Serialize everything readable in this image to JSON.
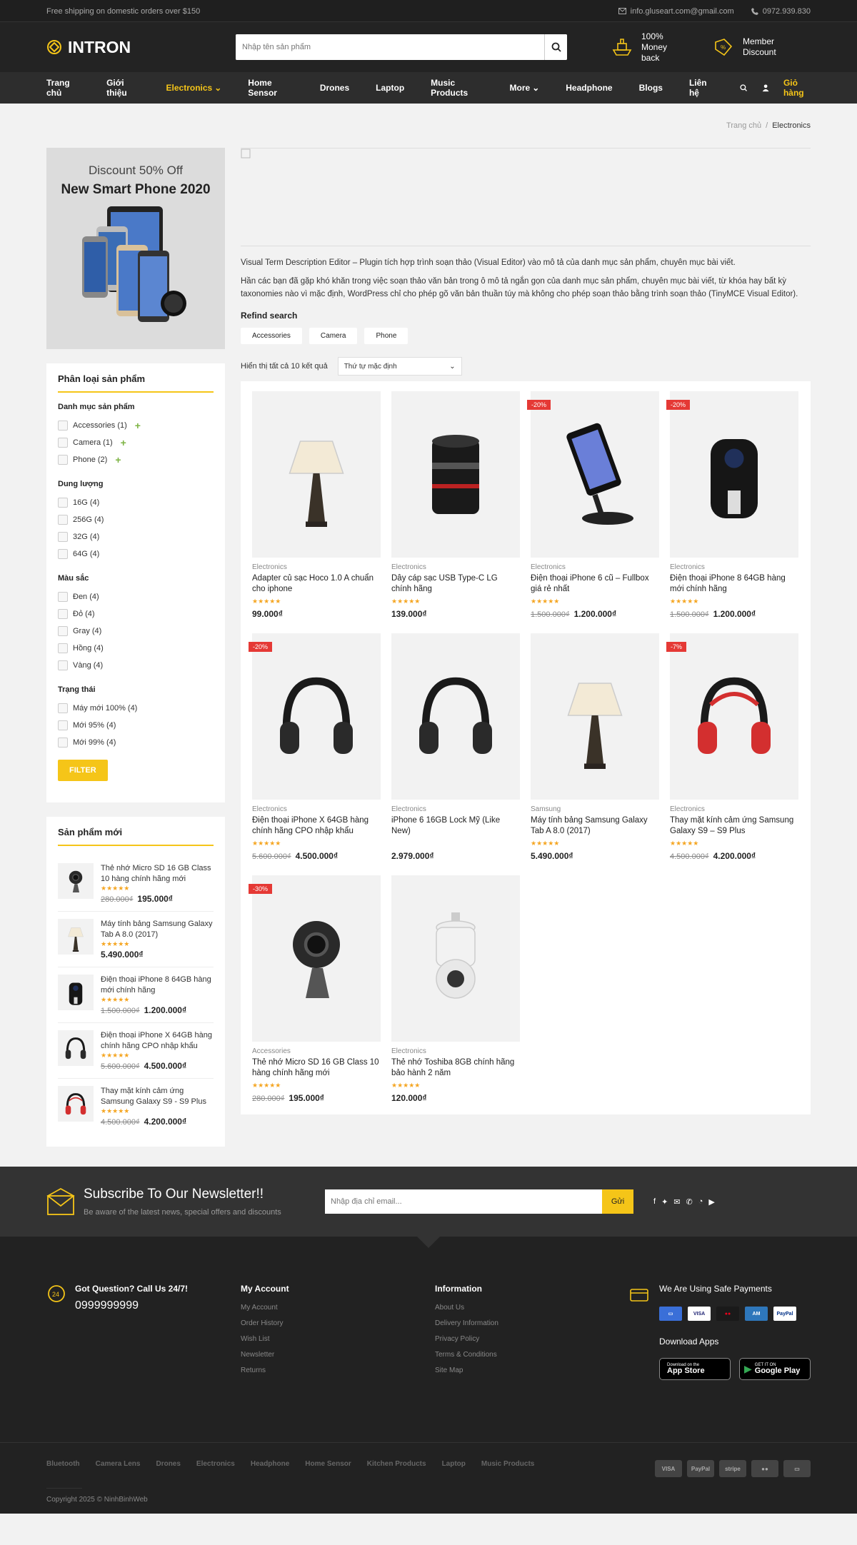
{
  "topbar": {
    "shipping": "Free shipping on domestic orders over $150",
    "email": "info.gluseart.com@gmail.com",
    "phone": "0972.939.830"
  },
  "header": {
    "logo": "INTRON",
    "search_placeholder": "Nhập tên sản phẩm",
    "perk1": "100% Money back",
    "perk2": "Member Discount"
  },
  "nav": {
    "items": [
      "Trang chủ",
      "Giới thiệu",
      "Electronics",
      "Home Sensor",
      "Drones",
      "Laptop",
      "Music Products",
      "More",
      "Headphone",
      "Blogs",
      "Liên hệ"
    ],
    "cart": "Giỏ hàng"
  },
  "breadcrumb": {
    "home": "Trang chủ",
    "sep": "/",
    "current": "Electronics"
  },
  "banner": {
    "line1": "Discount 50% Off",
    "line2": "New Smart Phone 2020"
  },
  "filters": {
    "title": "Phân loại sản phẩm",
    "cat_title": "Danh mục sản phẩm",
    "cats": [
      "Accessories (1)",
      "Camera (1)",
      "Phone (2)"
    ],
    "cap_title": "Dung lượng",
    "caps": [
      "16G (4)",
      "256G (4)",
      "32G (4)",
      "64G (4)"
    ],
    "color_title": "Màu sắc",
    "colors": [
      "Đen (4)",
      "Đỏ (4)",
      "Gray (4)",
      "Hồng (4)",
      "Vàng (4)"
    ],
    "state_title": "Trạng thái",
    "states": [
      "Máy mới 100% (4)",
      "Mới 95% (4)",
      "Mới 99% (4)"
    ],
    "button": "FILTER"
  },
  "newproducts": {
    "title": "Sản phẩm mới",
    "items": [
      {
        "name": "Thẻ nhớ Micro SD 16 GB Class 10 hàng chính hãng mới",
        "old": "280.000₫",
        "price": "195.000₫",
        "icon": "camera-icon"
      },
      {
        "name": "Máy tính bảng Samsung Galaxy Tab A 8.0 (2017)",
        "old": "",
        "price": "5.490.000₫",
        "icon": "lamp-icon"
      },
      {
        "name": "Điện thoại iPhone 8 64GB hàng mới chính hãng",
        "old": "1.500.000₫",
        "price": "1.200.000₫",
        "icon": "airfryer-icon"
      },
      {
        "name": "Điện thoại iPhone X 64GB hàng chính hãng CPO nhập khẩu",
        "old": "5.600.000₫",
        "price": "4.500.000₫",
        "icon": "headphone-icon"
      },
      {
        "name": "Thay mặt kính cảm ứng Samsung Galaxy S9 - S9 Plus",
        "old": "4.500.000₫",
        "price": "4.200.000₫",
        "icon": "headphone-red-icon"
      }
    ]
  },
  "content": {
    "desc1": "Visual Term Description Editor – Plugin tích hợp trình soạn thảo (Visual Editor) vào mô tả của danh mục sản phẩm, chuyên mục bài viết.",
    "desc2": "Hần các bạn đã gặp khó khăn trong việc soạn thảo văn bản trong ô mô tả ngắn gọn của danh mục sản phẩm, chuyên mục bài viết, từ khóa hay bất kỳ taxonomies nào vì mặc định, WordPress chỉ cho phép gõ văn bản thuần túy mà không cho phép soạn thảo bằng trình soạn thảo (TinyMCE Visual Editor).",
    "refind": "Refind search",
    "tags": [
      "Accessories",
      "Camera",
      "Phone"
    ],
    "result": "Hiển thị tất cả 10 kết quả",
    "sort": "Thứ tự mặc định"
  },
  "products": [
    {
      "cat": "Electronics",
      "name": "Adapter củ sạc Hoco 1.0 A chuẩn cho iphone",
      "old": "",
      "price": "99.000₫",
      "sale": "",
      "icon": "lamp-icon",
      "rating": 5
    },
    {
      "cat": "Electronics",
      "name": "Dây cáp sạc USB Type-C LG chính hãng",
      "old": "",
      "price": "139.000₫",
      "sale": "",
      "icon": "lens-icon",
      "rating": 5
    },
    {
      "cat": "Electronics",
      "name": "Điện thoại iPhone 6 cũ – Fullbox giá rẻ nhất",
      "old": "1.500.000₫",
      "price": "1.200.000₫",
      "sale": "-20%",
      "icon": "phone-mount-icon",
      "rating": 5
    },
    {
      "cat": "Electronics",
      "name": "Điện thoại iPhone 8 64GB hàng mới chính hãng",
      "old": "1.500.000₫",
      "price": "1.200.000₫",
      "sale": "-20%",
      "icon": "airfryer-icon",
      "rating": 4.5
    },
    {
      "cat": "Electronics",
      "name": "Điện thoại iPhone X 64GB hàng chính hãng CPO nhập khẩu",
      "old": "5.600.000₫",
      "price": "4.500.000₫",
      "sale": "-20%",
      "icon": "headphone-icon",
      "rating": 5
    },
    {
      "cat": "Electronics",
      "name": "iPhone 6 16GB Lock Mỹ (Like New)",
      "old": "",
      "price": "2.979.000₫",
      "sale": "",
      "icon": "headphone-icon",
      "rating": 0
    },
    {
      "cat": "Samsung",
      "name": "Máy tính bảng Samsung Galaxy Tab A 8.0 (2017)",
      "old": "",
      "price": "5.490.000₫",
      "sale": "",
      "icon": "lamp-icon",
      "rating": 5
    },
    {
      "cat": "Electronics",
      "name": "Thay mặt kính cảm ứng Samsung Galaxy S9 – S9 Plus",
      "old": "4.500.000₫",
      "price": "4.200.000₫",
      "sale": "-7%",
      "icon": "headphone-red-icon",
      "rating": 5
    },
    {
      "cat": "Accessories",
      "name": "Thẻ nhớ Micro SD 16 GB Class 10 hàng chính hãng mới",
      "old": "280.000₫",
      "price": "195.000₫",
      "sale": "-30%",
      "icon": "camera-icon",
      "rating": 5
    },
    {
      "cat": "Electronics",
      "name": "Thẻ nhớ Toshiba 8GB chính hãng bảo hành 2 năm",
      "old": "",
      "price": "120.000₫",
      "sale": "",
      "icon": "cctv-icon",
      "rating": 5
    }
  ],
  "newsletter": {
    "title": "Subscribe To Our Newsletter!!",
    "sub": "Be aware of the latest news, special offers and discounts",
    "placeholder": "Nhập địa chỉ email...",
    "button": "Gửi"
  },
  "footer": {
    "q": "Got Question? Call Us 24/7!",
    "phone": "0999999999",
    "account_title": "My Account",
    "account": [
      "My Account",
      "Order History",
      "Wish List",
      "Newsletter",
      "Returns"
    ],
    "info_title": "Information",
    "info": [
      "About Us",
      "Delivery Information",
      "Privacy Policy",
      "Terms & Conditions",
      "Site Map"
    ],
    "pay_title": "We Are Using Safe Payments",
    "apps_title": "Download Apps",
    "appstore_small": "Download on the",
    "appstore": "App Store",
    "gplay_small": "GET IT ON",
    "gplay": "Google Play",
    "cards": [
      "VISA",
      "PayPal"
    ],
    "bottom_tags": [
      "Bluetooth",
      "Camera Lens",
      "Drones",
      "Electronics",
      "Headphone",
      "Home Sensor",
      "Kitchen Products",
      "Laptop",
      "Music Products"
    ],
    "pay2": [
      "VISA",
      "PayPal",
      "stripe",
      "",
      ""
    ],
    "copyright": "Copyright 2025 © NinhBinhWeb"
  }
}
